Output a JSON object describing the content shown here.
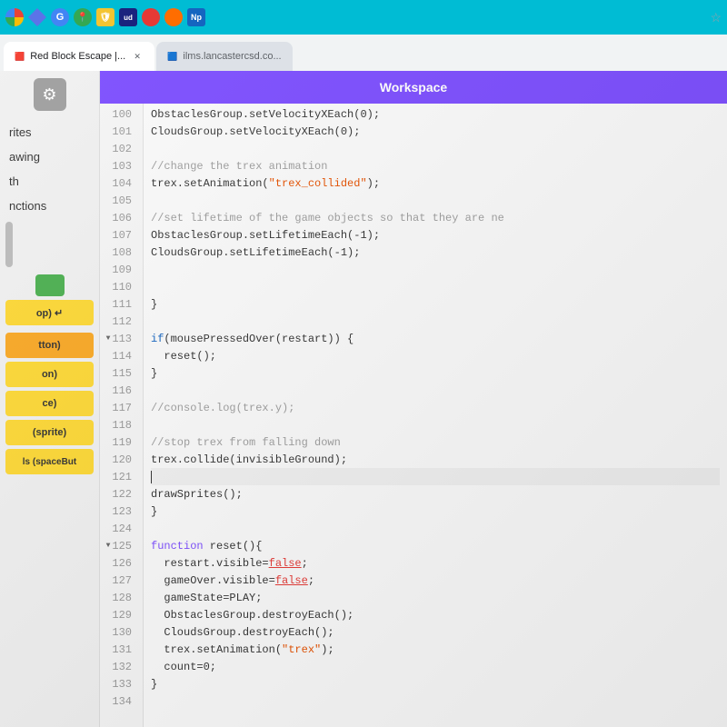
{
  "browser": {
    "top_bar_icons": [
      "chrome-icon",
      "diamond-icon",
      "google-icon",
      "maps-icon",
      "shield-icon",
      "ud-icon",
      "red-icon",
      "orange-icon",
      "np-icon"
    ],
    "tabs": [
      {
        "id": "tab-red-block",
        "label": "Red Block Escape |...",
        "active": true,
        "favicon": "🟥"
      },
      {
        "id": "tab-ilms",
        "label": "ilms.lancastercsd.co...",
        "active": false,
        "favicon": "🟦"
      }
    ],
    "star_icon": "☆"
  },
  "sidebar": {
    "gear_label": "⚙",
    "items": [
      {
        "id": "item-rites",
        "label": "rites"
      },
      {
        "id": "item-awing",
        "label": "awing"
      },
      {
        "id": "item-th",
        "label": "th"
      },
      {
        "id": "item-nctions",
        "label": "nctions"
      }
    ],
    "blocks": [
      {
        "id": "block-green",
        "label": "",
        "color": "green"
      },
      {
        "id": "block-op",
        "label": "op) ↵",
        "color": "yellow"
      },
      {
        "id": "block-tton",
        "label": "tton)",
        "color": "yellow-dark"
      },
      {
        "id": "block-on",
        "label": "on)",
        "color": "yellow"
      },
      {
        "id": "block-ce",
        "label": "ce)",
        "color": "yellow"
      },
      {
        "id": "block-sprite",
        "label": "(sprite)",
        "color": "yellow"
      },
      {
        "id": "block-spacebut",
        "label": "ls (spaceBut",
        "color": "yellow"
      }
    ]
  },
  "editor": {
    "header": "Workspace",
    "lines": [
      {
        "num": 100,
        "code": "ObstaclesGroup.setVelocityXEach(0);",
        "arrow": false
      },
      {
        "num": 101,
        "code": "CloudsGroup.setVelocityXEach(0);",
        "arrow": false
      },
      {
        "num": 102,
        "code": "",
        "arrow": false
      },
      {
        "num": 103,
        "code": "//change the trex animation",
        "comment": true,
        "arrow": false
      },
      {
        "num": 104,
        "code": "trex.setAnimation(\"trex_collided\");",
        "arrow": false
      },
      {
        "num": 105,
        "code": "",
        "arrow": false
      },
      {
        "num": 106,
        "code": "//set lifetime of the game objects so that they are ne",
        "comment": true,
        "arrow": false
      },
      {
        "num": 107,
        "code": "ObstaclesGroup.setLifetimeEach(-1);",
        "arrow": false
      },
      {
        "num": 108,
        "code": "CloudsGroup.setLifetimeEach(-1);",
        "arrow": false
      },
      {
        "num": 109,
        "code": "",
        "arrow": false
      },
      {
        "num": 110,
        "code": "",
        "arrow": false
      },
      {
        "num": 111,
        "code": "}",
        "arrow": false
      },
      {
        "num": 112,
        "code": "",
        "arrow": false
      },
      {
        "num": 113,
        "code": "if(mousePressedOver(restart)) {",
        "arrow": true,
        "is_if": true
      },
      {
        "num": 114,
        "code": "  reset();",
        "arrow": false
      },
      {
        "num": 115,
        "code": "}",
        "arrow": false
      },
      {
        "num": 116,
        "code": "",
        "arrow": false
      },
      {
        "num": 117,
        "code": "//console.log(trex.y);",
        "comment": true,
        "arrow": false
      },
      {
        "num": 118,
        "code": "",
        "arrow": false
      },
      {
        "num": 119,
        "code": "//stop trex from falling down",
        "comment": true,
        "arrow": false
      },
      {
        "num": 120,
        "code": "trex.collide(invisibleGround);",
        "arrow": false
      },
      {
        "num": 121,
        "code": "",
        "arrow": false,
        "cursor": true
      },
      {
        "num": 122,
        "code": "drawSprites();",
        "arrow": false
      },
      {
        "num": 123,
        "code": "}",
        "arrow": false
      },
      {
        "num": 124,
        "code": "",
        "arrow": false
      },
      {
        "num": 125,
        "code": "function reset(){",
        "arrow": true,
        "is_function": true
      },
      {
        "num": 126,
        "code": "  restart.visible=false;",
        "has_false": true,
        "arrow": false
      },
      {
        "num": 127,
        "code": "  gameOver.visible=false;",
        "has_false": true,
        "arrow": false
      },
      {
        "num": 128,
        "code": "  gameState=PLAY;",
        "arrow": false
      },
      {
        "num": 129,
        "code": "  ObstaclesGroup.destroyEach();",
        "arrow": false
      },
      {
        "num": 130,
        "code": "  CloudsGroup.destroyEach();",
        "arrow": false
      },
      {
        "num": 131,
        "code": "  trex.setAnimation(\"trex\");",
        "arrow": false
      },
      {
        "num": 132,
        "code": "  count=0;",
        "arrow": false
      },
      {
        "num": 133,
        "code": "}",
        "arrow": false
      },
      {
        "num": 134,
        "code": "",
        "arrow": false
      }
    ]
  }
}
